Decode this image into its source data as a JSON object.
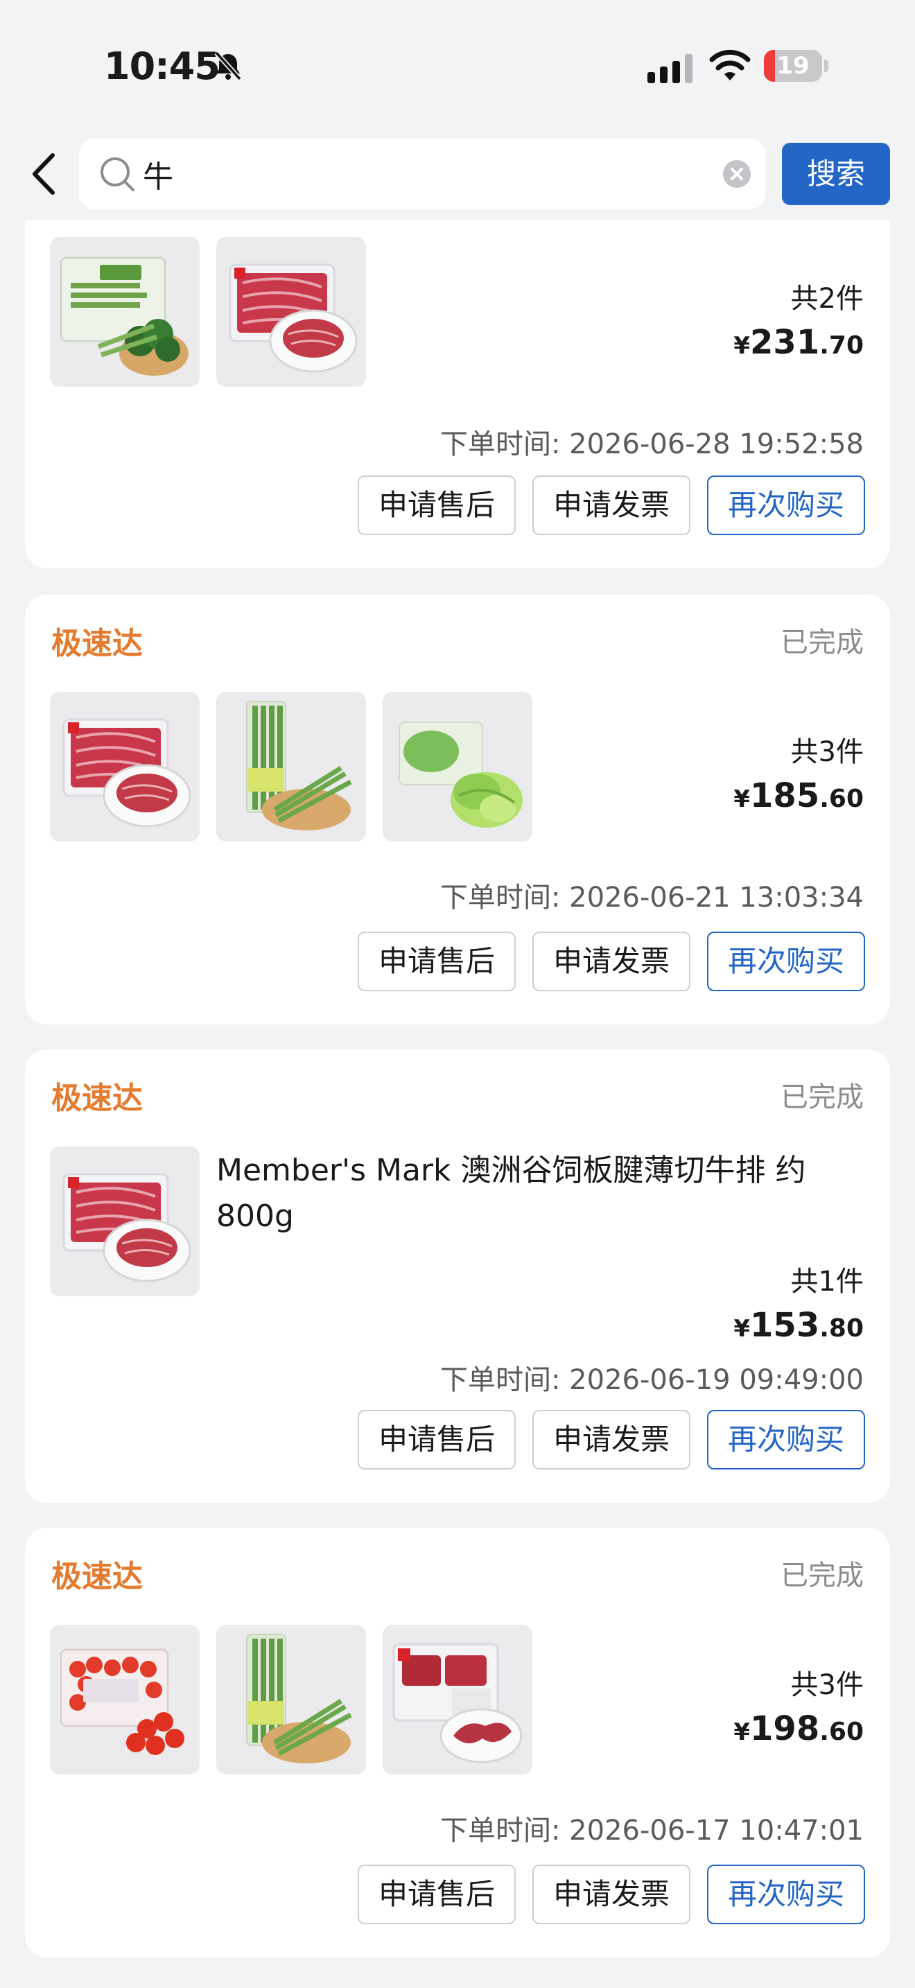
{
  "status_bar": {
    "time": "10:45",
    "battery": "19",
    "battery_level": 0.19
  },
  "search": {
    "query": "牛",
    "button_label": "搜索"
  },
  "labels": {
    "after_sale": "申请售后",
    "invoice": "申请发票",
    "rebuy": "再次购买",
    "time_prefix": "下单时间: "
  },
  "orders": [
    {
      "store": "",
      "status": "",
      "count": "共2件",
      "price_currency": "¥",
      "price_int": "231",
      "price_dec": ".70",
      "order_time": "2026-06-28 19:52:58",
      "items": [
        "broccoli",
        "beef"
      ]
    },
    {
      "store": "极速达",
      "status": "已完成",
      "count": "共3件",
      "price_currency": "¥",
      "price_int": "185",
      "price_dec": ".60",
      "order_time": "2026-06-21 13:03:34",
      "items": [
        "beef",
        "asparagus",
        "lettuce"
      ]
    },
    {
      "store": "极速达",
      "status": "已完成",
      "product_name": "Member's Mark 澳洲谷饲板腱薄切牛排   约800g",
      "count": "共1件",
      "price_currency": "¥",
      "price_int": "153",
      "price_dec": ".80",
      "order_time": "2026-06-19 09:49:00",
      "items": [
        "beef"
      ]
    },
    {
      "store": "极速达",
      "status": "已完成",
      "count": "共3件",
      "price_currency": "¥",
      "price_int": "198",
      "price_dec": ".60",
      "order_time": "2026-06-17 10:47:01",
      "items": [
        "tomato",
        "asparagus",
        "steak"
      ]
    }
  ],
  "colors": {
    "accent": "#2366c5",
    "store": "#e57b2f",
    "background": "#f2f3f5"
  }
}
